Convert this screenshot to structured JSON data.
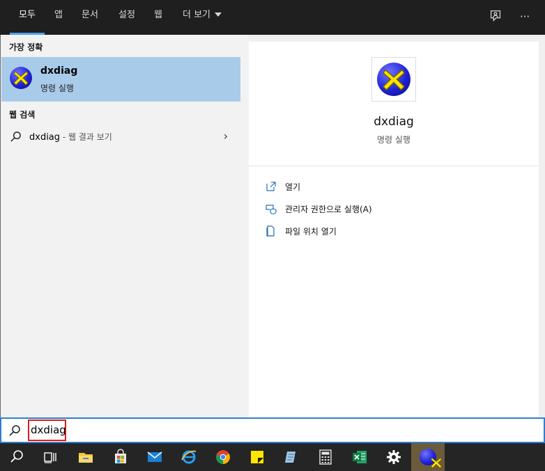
{
  "tabs": [
    {
      "label": "모두",
      "active": true
    },
    {
      "label": "앱"
    },
    {
      "label": "문서"
    },
    {
      "label": "설정"
    },
    {
      "label": "웹"
    },
    {
      "label": "더 보기"
    }
  ],
  "top_icons": [
    "feedback-icon",
    "more-options-icon"
  ],
  "more_glyph": "···",
  "best_match": {
    "heading": "가장 정확",
    "name": "dxdiag",
    "subtitle": "명령 실행"
  },
  "web_search": {
    "heading": "웹 검색",
    "query": "dxdiag",
    "hint": " - 웹 결과 보기",
    "chevron": "›"
  },
  "preview": {
    "title": "dxdiag",
    "subtitle": "명령 실행",
    "actions": [
      {
        "label": "열기",
        "icon": "open-icon"
      },
      {
        "label": "관리자 권한으로 실행(A)",
        "icon": "admin-shield-icon"
      },
      {
        "label": "파일 위치 열기",
        "icon": "file-location-icon"
      }
    ]
  },
  "search": {
    "value": "dxdiag"
  },
  "taskbar": [
    {
      "icon": "search-icon"
    },
    {
      "icon": "task-view-icon"
    },
    {
      "icon": "file-explorer-icon"
    },
    {
      "icon": "microsoft-store-icon"
    },
    {
      "icon": "mail-icon"
    },
    {
      "icon": "internet-explorer-icon"
    },
    {
      "icon": "chrome-icon"
    },
    {
      "icon": "sticky-notes-icon"
    },
    {
      "icon": "notepad-icon"
    },
    {
      "icon": "calculator-icon"
    },
    {
      "icon": "excel-icon"
    },
    {
      "icon": "settings-gear-icon"
    },
    {
      "icon": "dxdiag-icon",
      "active": true
    }
  ],
  "colors": {
    "accent": "#4ba0e8",
    "selected_row": "#a9cbea",
    "search_border": "#2c7fd0",
    "highlight_box": "#e11b1b"
  }
}
